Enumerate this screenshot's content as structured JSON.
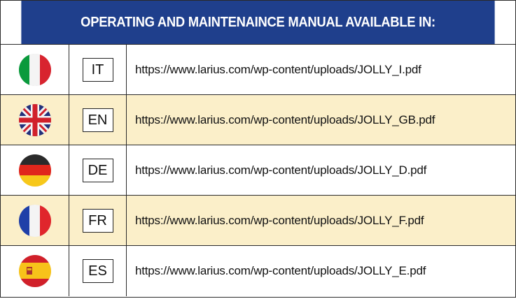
{
  "title": "OPERATING AND MAINTENAINCE MANUAL AVAILABLE IN:",
  "colors": {
    "header_bg": "#1f3f8c",
    "alt_row_bg": "#fbefc9"
  },
  "rows": [
    {
      "flag_icon": "italy-flag-icon",
      "code": "IT",
      "url": "https://www.larius.com/wp-content/uploads/JOLLY_I.pdf"
    },
    {
      "flag_icon": "uk-flag-icon",
      "code": "EN",
      "url": "https://www.larius.com/wp-content/uploads/JOLLY_GB.pdf"
    },
    {
      "flag_icon": "germany-flag-icon",
      "code": "DE",
      "url": "https://www.larius.com/wp-content/uploads/JOLLY_D.pdf"
    },
    {
      "flag_icon": "france-flag-icon",
      "code": "FR",
      "url": "https://www.larius.com/wp-content/uploads/JOLLY_F.pdf"
    },
    {
      "flag_icon": "spain-flag-icon",
      "code": "ES",
      "url": "https://www.larius.com/wp-content/uploads/JOLLY_E.pdf"
    }
  ]
}
